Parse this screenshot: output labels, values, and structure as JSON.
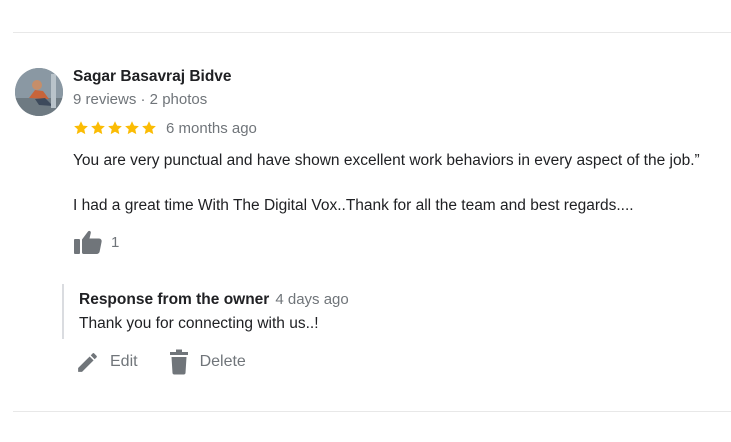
{
  "review": {
    "author": "Sagar Basavraj Bidve",
    "meta": "9 reviews · 2 photos",
    "rating": 5,
    "time": "6 months ago",
    "text_1": "You are very punctual and have shown excellent work behaviors in every aspect of the job.”",
    "text_2": "I had a great time With The Digital Vox..Thank for all the team and best regards....",
    "like_count": "1"
  },
  "owner_response": {
    "title": "Response from the owner",
    "time": "4 days ago",
    "text": "Thank you for connecting with us..!"
  },
  "actions": {
    "edit_label": "Edit",
    "delete_label": "Delete"
  },
  "colors": {
    "star": "#fbbc04",
    "icon": "#70757a",
    "secondary_text": "#70757a",
    "divider": "#e8e8e8"
  },
  "icons": {
    "like": "thumbs-up-icon",
    "edit": "pencil-icon",
    "delete": "trash-icon",
    "rating": "star-icon"
  }
}
